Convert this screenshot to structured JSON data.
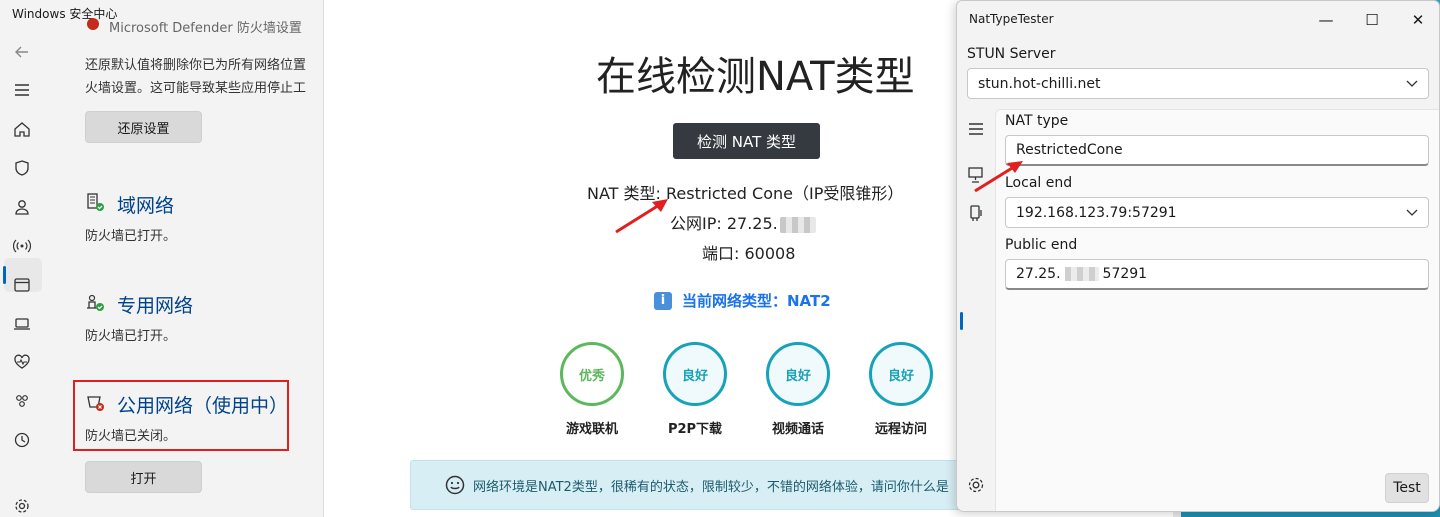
{
  "winsec": {
    "title": "Windows 安全中心",
    "cut_text": "Microsoft Defender 防火墙设置",
    "restore_desc_1": "还原默认值将删除你已为所有网络位置",
    "restore_desc_2": "火墙设置。这可能导致某些应用停止工",
    "restore_button": "还原设置",
    "domain": {
      "title": "域网络",
      "status": "防火墙已打开。"
    },
    "private": {
      "title": "专用网络",
      "status": "防火墙已打开。"
    },
    "public": {
      "title": "公用网络（使用中）",
      "status": "防火墙已关闭。",
      "button": "打开"
    },
    "rail_icons": [
      "back-arrow-icon",
      "hamburger-icon",
      "home-icon",
      "shield-icon",
      "person-icon",
      "wifi-antenna-icon",
      "app-window-icon",
      "laptop-icon",
      "heart-pulse-icon",
      "family-icon",
      "history-icon",
      "settings-gear-icon"
    ]
  },
  "webpage": {
    "heading": "在线检测NAT类型",
    "detect_button": "检测 NAT 类型",
    "nat_line": "NAT 类型: Restricted Cone（IP受限锥形）",
    "ip_label": "公网IP: 27.25.",
    "port_line": "端口: 60008",
    "current_type": "当前网络类型：NAT2",
    "gauges": [
      {
        "rating": "优秀",
        "label": "游戏联机"
      },
      {
        "rating": "良好",
        "label": "P2P下载"
      },
      {
        "rating": "良好",
        "label": "视频通话"
      },
      {
        "rating": "良好",
        "label": "远程访问"
      }
    ],
    "banner": "网络环境是NAT2类型，很稀有的状态，限制较少，不错的网络体验，请问你什么是"
  },
  "nattool": {
    "title": "NatTypeTester",
    "minimize": "—",
    "maximize": "☐",
    "close": "✕",
    "stun_label": "STUN Server",
    "stun_value": "stun.hot-chilli.net",
    "nat_type_label": "NAT type",
    "nat_type_value": "RestrictedCone",
    "local_end_label": "Local end",
    "local_end_value": "192.168.123.79:57291",
    "public_end_label": "Public end",
    "public_end_prefix": "27.25.",
    "public_end_suffix": "57291",
    "test_button": "Test"
  },
  "colors": {
    "accent_blue": "#0067c0",
    "link_blue": "#00438a",
    "arrow_red": "#e02020",
    "gauge_green": "#5cb85c",
    "gauge_teal": "#16a2b8",
    "nettype_blue": "#1a73e8"
  }
}
